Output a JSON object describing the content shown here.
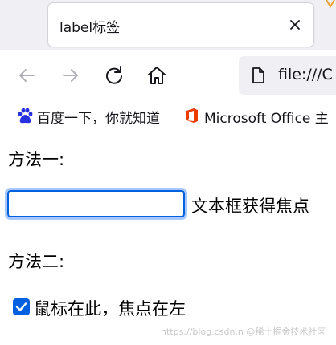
{
  "tab": {
    "title": "label标签"
  },
  "address_bar": {
    "url": "file:///C"
  },
  "bookmarks": [
    {
      "label": "百度一下，你就知道",
      "icon": "baidu-paw-icon"
    },
    {
      "label": "Microsoft Office 主",
      "icon": "office-icon"
    }
  ],
  "page": {
    "method1_heading": "方法一:",
    "method1_field_label": "文本框获得焦点",
    "method1_field_value": "",
    "method2_heading": "方法二:",
    "method2_checkbox_label": "鼠标在此，焦点在左",
    "method2_checked": true
  },
  "watermark": "https://blog.csdn.n @稀土掘金技术社区",
  "colors": {
    "accent": "#0060df",
    "focus_ring": "#a6c8ff",
    "baidu_blue": "#2932e1",
    "office_orange": "#eb3c00"
  }
}
